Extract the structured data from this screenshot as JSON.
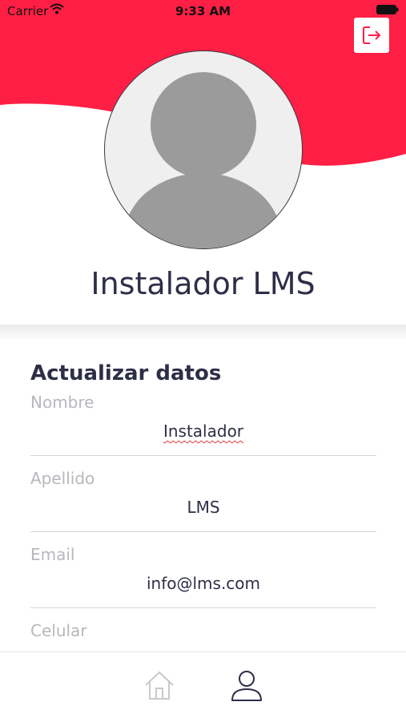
{
  "status_bar": {
    "carrier": "Carrier",
    "time": "9:33 AM"
  },
  "colors": {
    "accent": "#ff1f45",
    "text_dark": "#2d2f48",
    "label_gray": "#b7b7bd"
  },
  "header": {
    "logout_icon": "logout-icon"
  },
  "profile": {
    "name": "Instalador LMS",
    "avatar_icon": "user-avatar-placeholder"
  },
  "form": {
    "title": "Actualizar datos",
    "fields": [
      {
        "label": "Nombre",
        "value": "Instalador"
      },
      {
        "label": "Apellido",
        "value": "LMS"
      },
      {
        "label": "Email",
        "value": "info@lms.com"
      },
      {
        "label": "Celular",
        "value": ""
      }
    ]
  },
  "tab_bar": {
    "items": [
      {
        "icon": "home-icon",
        "active": false
      },
      {
        "icon": "user-icon",
        "active": true
      }
    ]
  }
}
